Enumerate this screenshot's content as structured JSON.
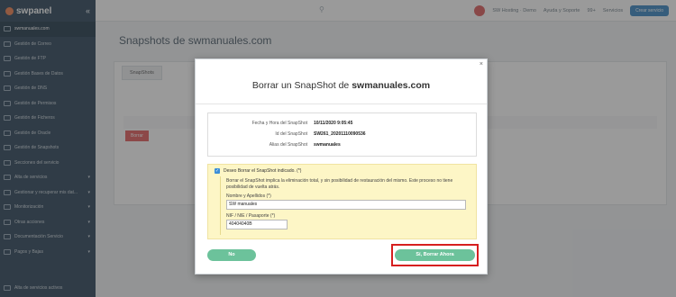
{
  "app": {
    "brand": "swpanel"
  },
  "sidebar": {
    "items": [
      {
        "label": "swmanuales.com",
        "active": true,
        "chevron": false
      },
      {
        "label": "Gestión de Correo",
        "chevron": false
      },
      {
        "label": "Gestión de FTP",
        "chevron": false
      },
      {
        "label": "Gestión Bases de Datos",
        "chevron": false
      },
      {
        "label": "Gestión de DNS",
        "chevron": false
      },
      {
        "label": "Gestión de Permisos",
        "chevron": false
      },
      {
        "label": "Gestión de Ficheros",
        "chevron": false
      },
      {
        "label": "Gestión de Oracle",
        "chevron": false
      },
      {
        "label": "Gestión de Snapshots",
        "chevron": false
      },
      {
        "label": "Secciones del servicio",
        "chevron": false
      },
      {
        "label": "Alta de servicios",
        "chevron": true
      },
      {
        "label": "Gestionar y recuperar mis dat...",
        "chevron": true
      },
      {
        "label": "Monitorización",
        "chevron": true
      },
      {
        "label": "Otras acciones",
        "chevron": true
      },
      {
        "label": "Documentación Servicio",
        "chevron": true
      },
      {
        "label": "Pagos y Bajas",
        "chevron": true
      }
    ],
    "footer": "Alta de servicios activos"
  },
  "topbar": {
    "account": "SW Hosting · Demo",
    "help": "Ayuda y Soporte",
    "help_badge": "99+",
    "services": "Servicios",
    "cta": "Crear servicio"
  },
  "page": {
    "title": "Snapshots de swmanuales.com",
    "tab": "SnapShots",
    "row_badge": "Borrar"
  },
  "modal": {
    "title_prefix": "Borrar un SnapShot de ",
    "title_domain": "swmanuales.com",
    "info": [
      {
        "label": "Fecha y Hora del SnapShot",
        "value": "10/11/2020 9:05:45"
      },
      {
        "label": "Id del SnapShot",
        "value": "SW261_20201110090536"
      },
      {
        "label": "Alias del SnapShot",
        "value": "swmanuales"
      }
    ],
    "confirm_label": "Deseo Borrar el SnapShot indicado. (*)",
    "warning": "Borrar el SnapShot implica la eliminación total, y sin posibilidad de restauración del mismo. Este proceso no tiene posibilidad de vuelta atrás.",
    "name_label": "Nombre y Apellidos (*)",
    "name_value": "SW manuales",
    "nif_label": "NIF / NIE / Pasaporte (*)",
    "nif_value": "40404040B",
    "no_button": "No",
    "yes_button": "Sí, Borrar Ahora",
    "highlight_color": "#d61f1f",
    "button_color": "#6cc29b"
  }
}
